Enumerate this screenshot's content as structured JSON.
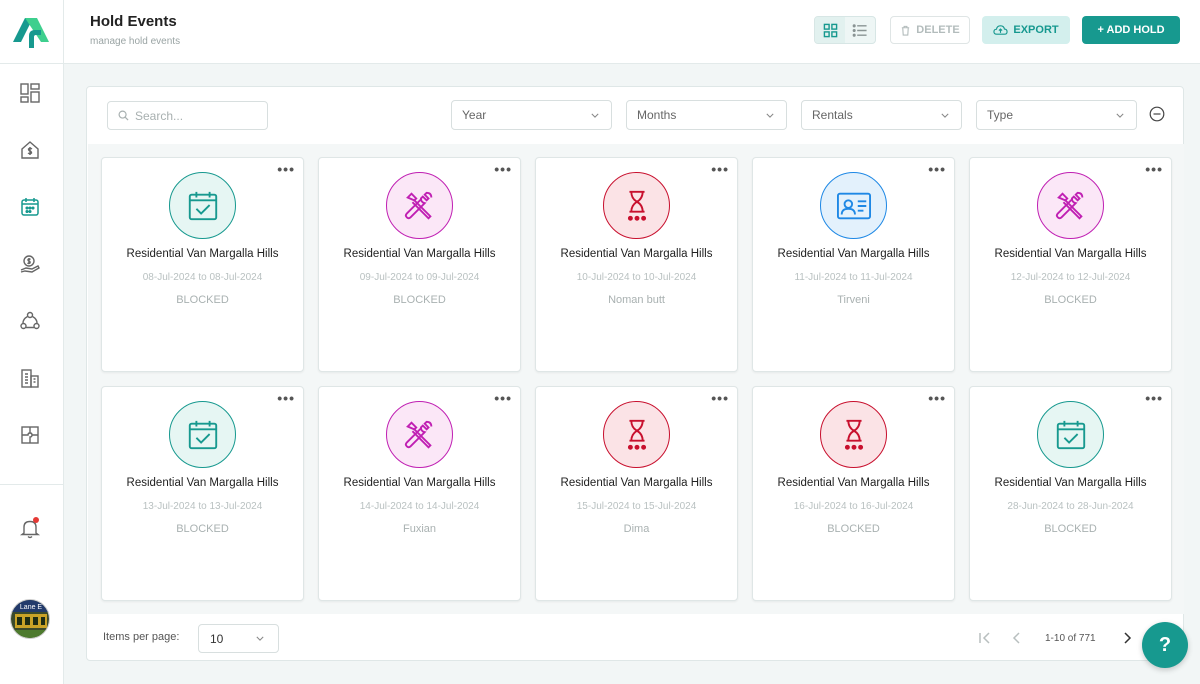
{
  "header": {
    "title": "Hold Events",
    "subtitle": "manage hold events",
    "delete_label": "DELETE",
    "export_label": "EXPORT",
    "add_label": "+ ADD HOLD"
  },
  "filters": {
    "search_placeholder": "Search...",
    "year": "Year",
    "months": "Months",
    "rentals": "Rentals",
    "type": "Type"
  },
  "icons": {
    "calendar": {
      "name": "calendar-check-icon",
      "bg": "#e6f6f3",
      "stroke": "#17998f"
    },
    "tools": {
      "name": "tools-icon",
      "bg": "#fbe7f7",
      "stroke": "#c020b3"
    },
    "hourglass": {
      "name": "hourglass-icon",
      "bg": "#fbe3e6",
      "stroke": "#c8102e"
    },
    "idcard": {
      "name": "id-card-icon",
      "bg": "#e3f1fc",
      "stroke": "#1e88e5"
    }
  },
  "cards": [
    {
      "icon": "calendar",
      "title": "Residential Van Margalla Hills",
      "dates": "08-Jul-2024 to 08-Jul-2024",
      "status": "BLOCKED"
    },
    {
      "icon": "tools",
      "title": "Residential Van Margalla Hills",
      "dates": "09-Jul-2024 to 09-Jul-2024",
      "status": "BLOCKED"
    },
    {
      "icon": "hourglass",
      "title": "Residential Van Margalla Hills",
      "dates": "10-Jul-2024 to 10-Jul-2024",
      "status": "Noman butt"
    },
    {
      "icon": "idcard",
      "title": "Residential Van Margalla Hills",
      "dates": "11-Jul-2024 to 11-Jul-2024",
      "status": "Tirveni"
    },
    {
      "icon": "tools",
      "title": "Residential Van Margalla Hills",
      "dates": "12-Jul-2024 to 12-Jul-2024",
      "status": "BLOCKED"
    },
    {
      "icon": "calendar",
      "title": "Residential Van Margalla Hills",
      "dates": "13-Jul-2024 to 13-Jul-2024",
      "status": "BLOCKED"
    },
    {
      "icon": "tools",
      "title": "Residential Van Margalla Hills",
      "dates": "14-Jul-2024 to 14-Jul-2024",
      "status": "Fuxian"
    },
    {
      "icon": "hourglass",
      "title": "Residential Van Margalla Hills",
      "dates": "15-Jul-2024 to 15-Jul-2024",
      "status": "Dima"
    },
    {
      "icon": "hourglass",
      "title": "Residential Van Margalla Hills",
      "dates": "16-Jul-2024 to 16-Jul-2024",
      "status": "BLOCKED"
    },
    {
      "icon": "calendar",
      "title": "Residential Van Margalla Hills",
      "dates": "28-Jun-2024 to 28-Jun-2024",
      "status": "BLOCKED"
    }
  ],
  "pagination": {
    "items_per_page_label": "Items per page:",
    "items_per_page": "10",
    "range": "1-10 of 771"
  },
  "help_label": "?",
  "avatar_text": "Lane E"
}
